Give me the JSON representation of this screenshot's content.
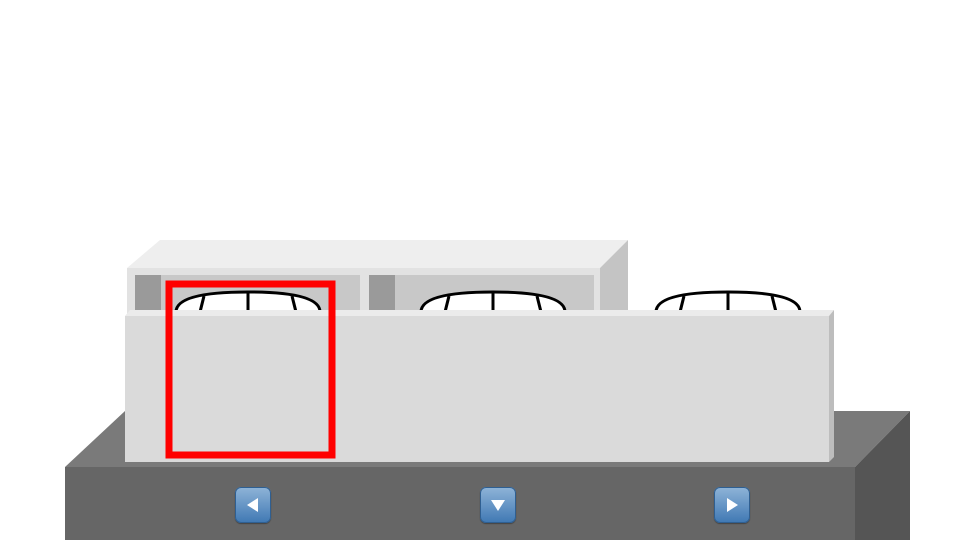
{
  "scene": {
    "description_free": true,
    "colors": {
      "background": "#ffffff",
      "platform_top": "#7a7a7a",
      "platform_front": "#666666",
      "platform_side": "#555555",
      "unit_top": "#ebebeb",
      "unit_front": "#dadada",
      "unit_right": "#bdbdbd",
      "fan_bay": "#c8c8c8",
      "fan_bay_dark": "#9a9a9a",
      "selection": "#ff0000",
      "button": "#5b8fc5"
    },
    "fans": [
      {
        "name": "fan-1"
      },
      {
        "name": "fan-2"
      },
      {
        "name": "fan-3"
      }
    ],
    "selected_fan_index": 0
  },
  "controls": {
    "left_icon": "triangle-left-icon",
    "down_icon": "triangle-down-icon",
    "right_icon": "triangle-right-icon"
  }
}
